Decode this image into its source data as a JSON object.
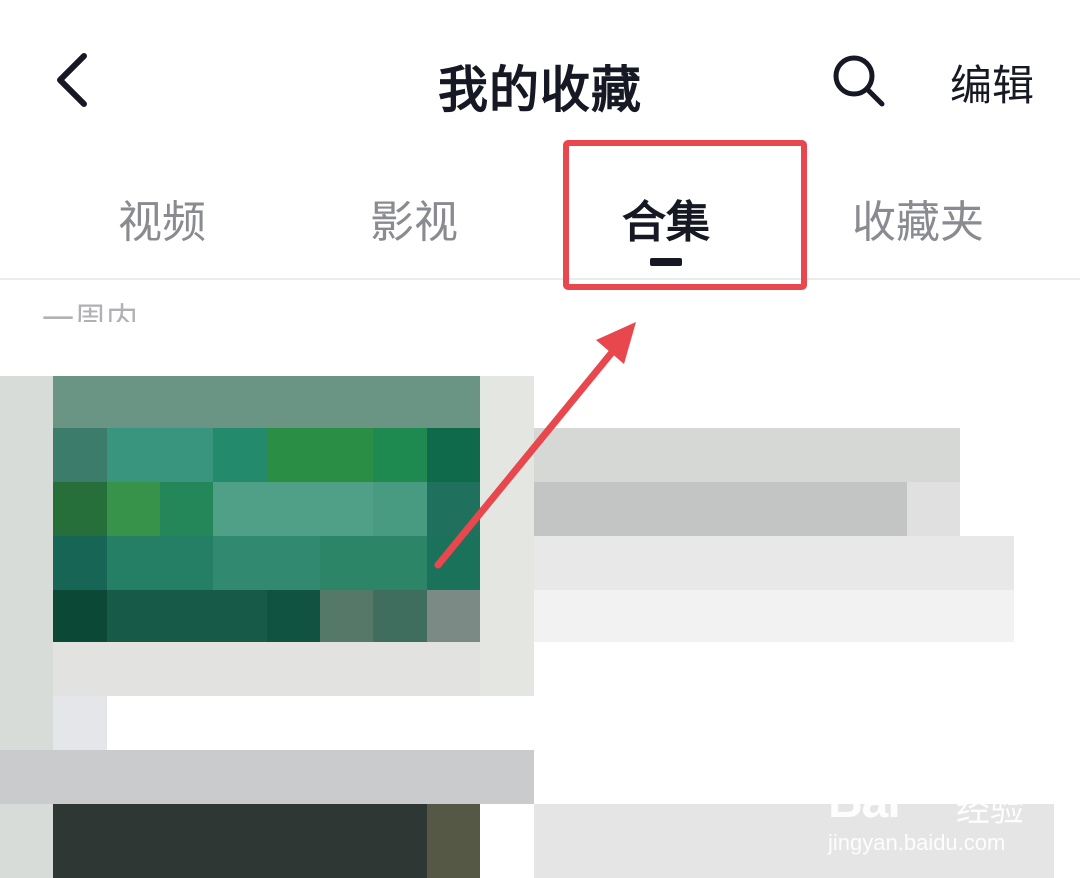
{
  "header": {
    "title": "我的收藏",
    "edit_label": "编辑",
    "back_icon": "chevron-left-icon",
    "search_icon": "search-icon"
  },
  "tabs": [
    {
      "label": "视频",
      "active": false
    },
    {
      "label": "影视",
      "active": false
    },
    {
      "label": "合集",
      "active": true
    },
    {
      "label": "收藏夹",
      "active": false
    }
  ],
  "section": {
    "label": "一周内"
  },
  "annotation": {
    "box_color": "#e8474d",
    "arrow_color": "#e8474d"
  },
  "watermark": {
    "brand": "Bai",
    "brand_sub": "经验",
    "url": "jingyan.baidu.com"
  }
}
